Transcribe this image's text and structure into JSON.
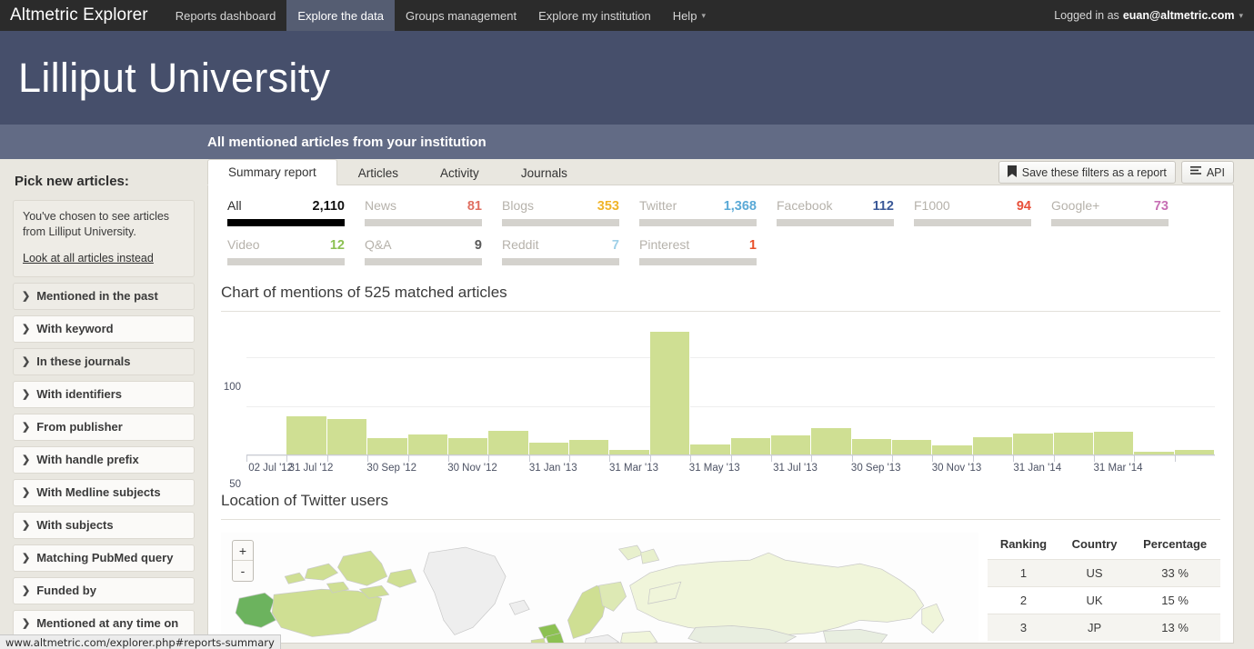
{
  "topnav": {
    "brand": "Altmetric Explorer",
    "items": [
      {
        "label": "Reports dashboard",
        "active": false
      },
      {
        "label": "Explore the data",
        "active": true
      },
      {
        "label": "Groups management",
        "active": false
      },
      {
        "label": "Explore my institution",
        "active": false
      },
      {
        "label": "Help",
        "active": false,
        "caret": true
      }
    ],
    "login_prefix": "Logged in as",
    "login_user": "euan@altmetric.com"
  },
  "hero": {
    "title": "Lilliput University",
    "subbar": "All mentioned articles from your institution"
  },
  "sidebar": {
    "heading": "Pick new articles:",
    "chosen_text": "You've chosen to see articles from Lilliput University.",
    "chosen_link": "Look at all articles instead",
    "filters": [
      "Mentioned in the past",
      "With keyword",
      "In these journals",
      "With identifiers",
      "From publisher",
      "With handle prefix",
      "With Medline subjects",
      "With subjects",
      "Matching PubMed query",
      "Funded by",
      "Mentioned at any time on"
    ]
  },
  "tabs": [
    {
      "label": "Summary report",
      "active": true
    },
    {
      "label": "Articles",
      "active": false
    },
    {
      "label": "Activity",
      "active": false
    },
    {
      "label": "Journals",
      "active": false
    }
  ],
  "actions": {
    "save_label": "Save these filters as a report",
    "api_label": "API"
  },
  "stats": [
    {
      "label": "All",
      "value": "2,110",
      "color": "#111111",
      "bar": "#000000"
    },
    {
      "label": "News",
      "value": "81",
      "color": "#e06f61",
      "bar": "#d4d2cd"
    },
    {
      "label": "Blogs",
      "value": "353",
      "color": "#f0b429",
      "bar": "#d4d2cd"
    },
    {
      "label": "Twitter",
      "value": "1,368",
      "color": "#5aa9d6",
      "bar": "#d4d2cd"
    },
    {
      "label": "Facebook",
      "value": "112",
      "color": "#3b5998",
      "bar": "#d4d2cd"
    },
    {
      "label": "F1000",
      "value": "94",
      "color": "#e8503a",
      "bar": "#d4d2cd"
    },
    {
      "label": "Google+",
      "value": "73",
      "color": "#c76fb4",
      "bar": "#d4d2cd"
    },
    {
      "label": "Video",
      "value": "12",
      "color": "#8cc152",
      "bar": "#d4d2cd"
    },
    {
      "label": "Q&A",
      "value": "9",
      "color": "#5a5a5a",
      "bar": "#d4d2cd"
    },
    {
      "label": "Reddit",
      "value": "7",
      "color": "#9fd0e8",
      "bar": "#d4d2cd"
    },
    {
      "label": "Pinterest",
      "value": "1",
      "color": "#e8502a",
      "bar": "#d4d2cd"
    }
  ],
  "chart_section_title": "Chart of mentions of 525 matched articles",
  "chart_data": {
    "type": "bar",
    "title": "Chart of mentions of 525 matched articles",
    "xlabel": "",
    "ylabel": "",
    "ylim": [
      0,
      130
    ],
    "yticks": [
      0,
      50,
      100
    ],
    "grid": true,
    "legend": "none",
    "bar_color": "#cfdf93",
    "x_tick_labels": [
      "02 Jul '12",
      "31 Jul '12",
      "30 Sep '12",
      "30 Nov '12",
      "31 Jan '13",
      "31 Mar '13",
      "31 May '13",
      "31 Jul '13",
      "30 Sep '13",
      "30 Nov '13",
      "31 Jan '14",
      "31 Mar '14"
    ],
    "values": [
      0,
      40,
      37,
      18,
      21,
      18,
      25,
      13,
      16,
      6,
      126,
      11,
      18,
      20,
      28,
      17,
      16,
      10,
      19,
      22,
      23,
      24,
      4,
      6
    ]
  },
  "map_section_title": "Location of Twitter users",
  "map_zoom": {
    "in": "+",
    "out": "-"
  },
  "country_table": {
    "headers": [
      "Ranking",
      "Country",
      "Percentage"
    ],
    "rows": [
      [
        "1",
        "US",
        "33 %"
      ],
      [
        "2",
        "UK",
        "15 %"
      ],
      [
        "3",
        "JP",
        "13 %"
      ]
    ]
  },
  "statusbar": {
    "url": "www.altmetric.com/explorer.php#reports-summary"
  }
}
